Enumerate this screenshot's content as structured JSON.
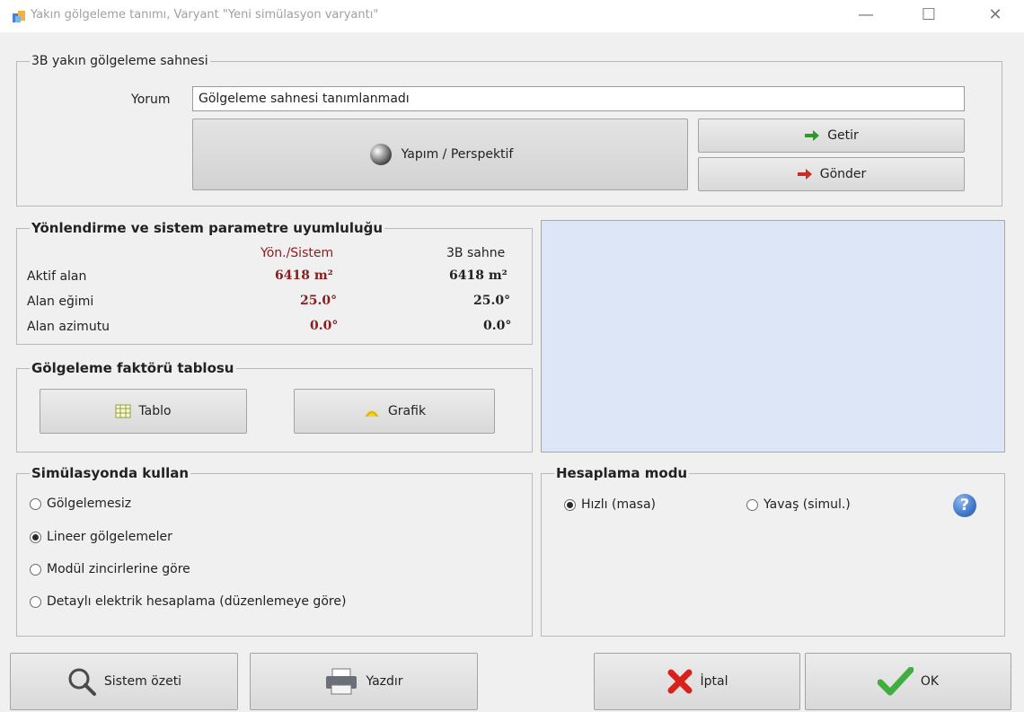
{
  "window": {
    "title": "Yakın gölgeleme tanımı, Varyant \"Yeni simülasyon varyantı\"",
    "minimize": "—",
    "maximize": "☐",
    "close": "✕"
  },
  "scene": {
    "group_label": "3B yakın gölgeleme sahnesi",
    "comment_label": "Yorum",
    "comment_value": "Gölgeleme sahnesi tanımlanmadı",
    "construct_label": "Yapım / Perspektif",
    "import_label": "Getir",
    "export_label": "Gönder"
  },
  "compat": {
    "group_label": "Yönlendirme ve sistem parametre uyumluluğu",
    "col1_header": "Yön./Sistem",
    "col2_header": "3B sahne",
    "rows": [
      {
        "label": "Aktif alan",
        "sys": "6418 m²",
        "scene": "6418 m²"
      },
      {
        "label": "Alan eğimi",
        "sys": "25.0°",
        "scene": "25.0°"
      },
      {
        "label": "Alan azimutu",
        "sys": "0.0°",
        "scene": "0.0°"
      }
    ]
  },
  "factor": {
    "group_label": "Gölgeleme faktörü tablosu",
    "table_label": "Tablo",
    "graph_label": "Grafik"
  },
  "use": {
    "group_label": "Simülasyonda kullan",
    "options": [
      {
        "label": "Gölgelemesiz",
        "selected": false
      },
      {
        "label": "Lineer gölgelemeler",
        "selected": true
      },
      {
        "label": "Modül zincirlerine göre",
        "selected": false
      },
      {
        "label": "Detaylı elektrik hesaplama (düzenlemeye göre)",
        "selected": false
      }
    ]
  },
  "calc": {
    "group_label": "Hesaplama modu",
    "fast_label": "Hızlı (masa)",
    "slow_label": "Yavaş (simul.)",
    "selected": "fast",
    "help": "?"
  },
  "footer": {
    "summary_label": "Sistem özeti",
    "print_label": "Yazdır",
    "cancel_label": "İptal",
    "ok_label": "OK"
  },
  "colors": {
    "preview_bg": "#dce6f7",
    "accent_red": "#8b1c1c",
    "ok_green": "#3fae3f",
    "cancel_red": "#d9211c",
    "help_blue": "#3f78c8"
  }
}
